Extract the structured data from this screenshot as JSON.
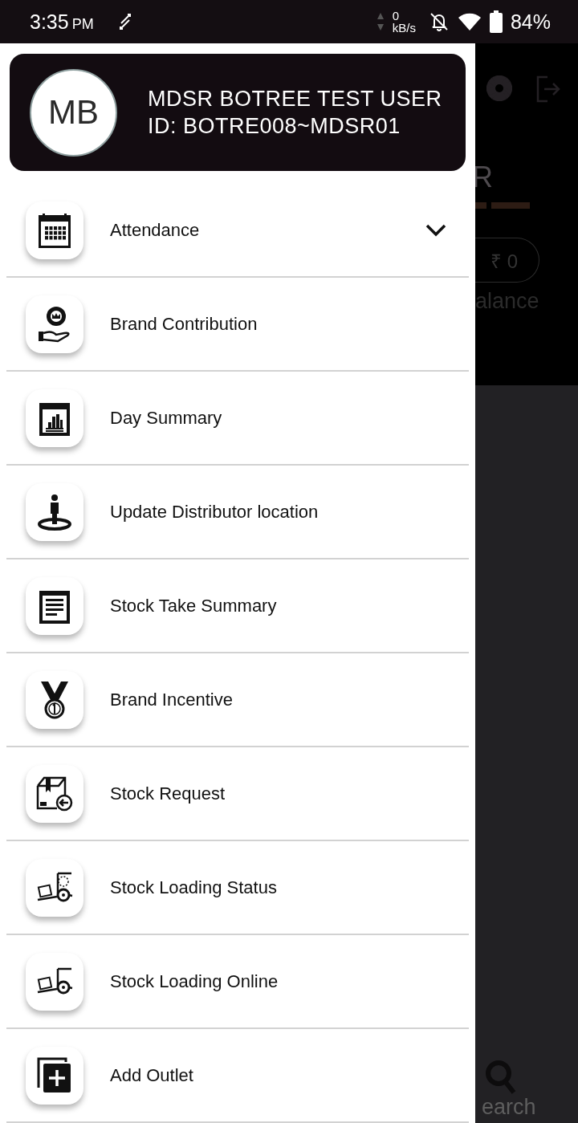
{
  "status_bar": {
    "time": "3:35",
    "time_suffix": "PM",
    "data_rate_value": "0",
    "data_rate_unit": "kB/s",
    "battery": "84%"
  },
  "profile": {
    "initials": "MB",
    "name": "MDSR BOTREE TEST USER",
    "id": "ID: BOTRE008~MDSR01"
  },
  "menu": [
    {
      "label": "Attendance",
      "kind": "group",
      "expanded": false
    },
    {
      "label": "Brand Contribution",
      "kind": "link"
    },
    {
      "label": "Day Summary",
      "kind": "link"
    },
    {
      "label": "Update Distributor location",
      "kind": "link"
    },
    {
      "label": "Stock Take Summary",
      "kind": "link"
    },
    {
      "label": "Brand Incentive",
      "kind": "link"
    },
    {
      "label": "Stock Request",
      "kind": "link"
    },
    {
      "label": "Stock Loading Status",
      "kind": "link"
    },
    {
      "label": "Stock Loading Online",
      "kind": "link"
    },
    {
      "label": "Add Outlet",
      "kind": "link"
    }
  ],
  "background": {
    "title_fragment": "R",
    "balance": "₹ 0",
    "balance_label": "alance",
    "nav_label": "earch"
  }
}
